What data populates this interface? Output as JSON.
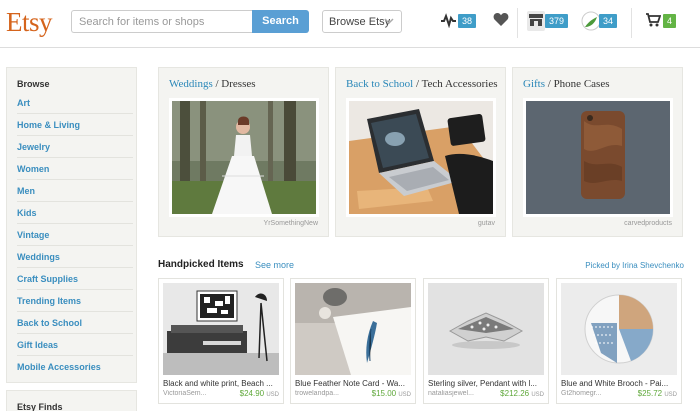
{
  "header": {
    "logo": "Etsy",
    "search_placeholder": "Search for items or shops",
    "search_button": "Search",
    "browse_label": "Browse Etsy",
    "activity_count": "38",
    "shop_count": "379",
    "avatar_count": "34",
    "cart_count": "4"
  },
  "sidebar": {
    "title": "Browse",
    "items": [
      "Art",
      "Home & Living",
      "Jewelry",
      "Women",
      "Men",
      "Kids",
      "Vintage",
      "Weddings",
      "Craft Supplies",
      "Trending Items",
      "Back to School",
      "Gift Ideas",
      "Mobile Accessories"
    ],
    "finds_title": "Etsy Finds"
  },
  "featured": [
    {
      "category": "Weddings",
      "sub": "Dresses",
      "credit": "YrSomethingNew"
    },
    {
      "category": "Back to School",
      "sub": "Tech Accessories",
      "credit": "gutav"
    },
    {
      "category": "Gifts",
      "sub": "Phone Cases",
      "credit": "carvedproducts"
    }
  ],
  "handpicked": {
    "title": "Handpicked Items",
    "see_more": "See more",
    "picked_by": "Picked by Irina Shevchenko",
    "currency": "USD",
    "items": [
      {
        "name": "Black and white print, Beach ...",
        "shop": "VictoriaSem...",
        "price": "$24.90"
      },
      {
        "name": "Blue Feather Note Card - Wa...",
        "shop": "trowelandpa...",
        "price": "$15.00"
      },
      {
        "name": "Sterling silver, Pendant with l...",
        "shop": "nataliasjewel...",
        "price": "$212.26"
      },
      {
        "name": "Blue and White Brooch - Pai...",
        "shop": "Gt2homegr...",
        "price": "$25.72"
      }
    ]
  },
  "colors": {
    "brand": "#d5641c",
    "link": "#3a8ebf",
    "badge": "#3f9dc8",
    "cart_badge": "#63b445",
    "price": "#5fa83a"
  }
}
